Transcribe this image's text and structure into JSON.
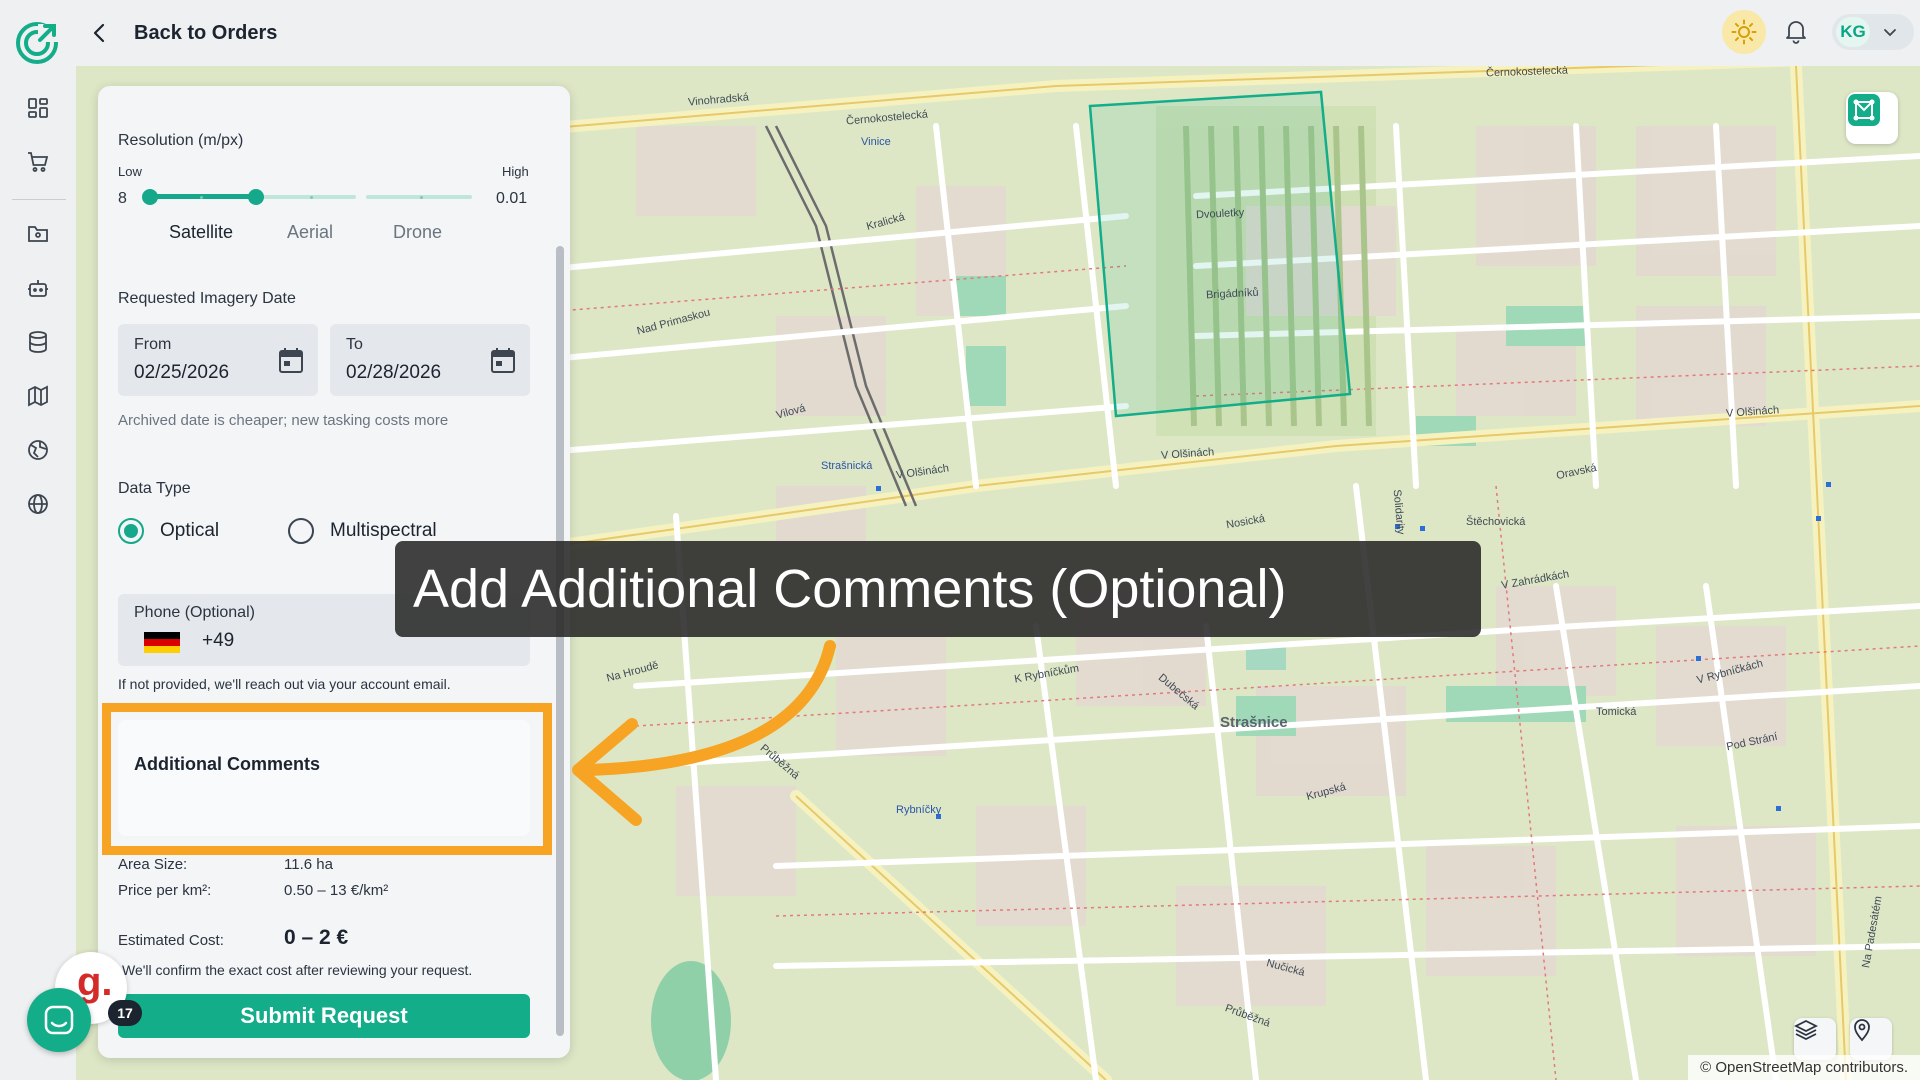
{
  "header": {
    "back_label": "Back to Orders",
    "user_initials": "KG"
  },
  "nav": {
    "items": [
      {
        "name": "dashboard-icon"
      },
      {
        "name": "cart-icon"
      },
      {
        "name": "folder-icon"
      },
      {
        "name": "robot-icon"
      },
      {
        "name": "database-icon"
      },
      {
        "name": "map-icon"
      },
      {
        "name": "globe-grid-icon"
      },
      {
        "name": "globe-icon"
      }
    ]
  },
  "panel": {
    "resolution": {
      "label": "Resolution (m/px)",
      "low_label": "Low",
      "high_label": "High",
      "low_value": "8",
      "high_value": "0.01",
      "sensors": [
        "Satellite",
        "Aerial",
        "Drone"
      ],
      "selected_fraction": 0.29
    },
    "imagery_date": {
      "label": "Requested Imagery Date",
      "from_label": "From",
      "from_value": "02/25/2026",
      "to_label": "To",
      "to_value": "02/28/2026",
      "hint": "Archived date is cheaper; new tasking costs more"
    },
    "data_type": {
      "label": "Data Type",
      "options": [
        "Optical",
        "Multispectral"
      ],
      "selected": "Optical"
    },
    "phone": {
      "label": "Phone (Optional)",
      "value": "+49",
      "hint": "If not provided, we'll reach out via your account email."
    },
    "comments": {
      "label": "Additional Comments"
    },
    "summary": {
      "area_label": "Area Size:",
      "area_value": "11.6 ha",
      "price_label": "Price per km²:",
      "price_value": "0.50 – 13 €/km²",
      "cost_label": "Estimated Cost:",
      "cost_value": "0 – 2 €",
      "note": "We'll confirm the exact cost after reviewing your request."
    },
    "submit_label": "Submit Request"
  },
  "callout": {
    "text": "Add Additional Comments (Optional)"
  },
  "map": {
    "streets": [
      "Vinohradská",
      "Černokostelecká",
      "Černokostelecká",
      "V Olšinách",
      "V Olšinách",
      "V Olšinách",
      "Dvouletky",
      "Brigádníků",
      "Nad Primaskou",
      "Vilová",
      "Strašnická",
      "Na Hroudě",
      "K Rybníčkům",
      "Dubečská",
      "Průběžná",
      "Průběžná",
      "Nučická",
      "Krupská",
      "V Rybníčkách",
      "Tomická",
      "Pod Strání",
      "Oravská",
      "Štěchovická",
      "Nosická",
      "Rybníčky",
      "V Zahrádkách",
      "Na Padesátém",
      "Solidarity",
      "Kralická",
      "Vinice"
    ],
    "district": "Strašnice",
    "attribution": "© OpenStreetMap contributors."
  },
  "widgets": {
    "brand_letter": "g.",
    "badge_count": "17"
  },
  "colors": {
    "accent": "#13ad8a",
    "highlight": "#f7a424",
    "callout_bg": "#282828"
  }
}
